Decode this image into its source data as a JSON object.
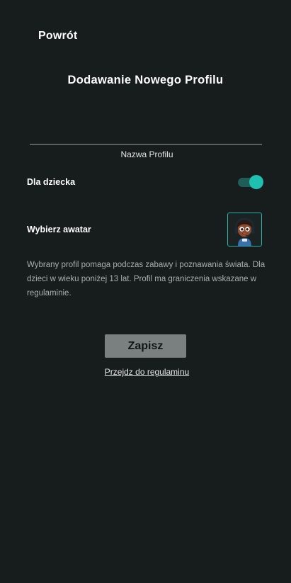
{
  "header": {
    "back_label": "Powrót",
    "title": "Dodawanie Nowego Profilu"
  },
  "form": {
    "name_value": "",
    "name_placeholder": "",
    "name_label": "Nazwa Profilu",
    "child_label": "Dla dziecka",
    "child_toggle_on": true,
    "avatar_label": "Wybierz awatar",
    "avatar_icon": "child-with-headphones-avatar-icon",
    "description": "Wybrany profil pomaga podczas zabawy i poznawania świata. Dla dzieci w wieku poniżej 13 lat. Profil ma graniczenia wskazane w regulaminie."
  },
  "actions": {
    "save_label": "Zapisz",
    "terms_link": "Przejdz do regulaminu"
  },
  "colors": {
    "background": "#171c1c",
    "accent": "#1ec0b0",
    "button": "#7a7f7f"
  }
}
